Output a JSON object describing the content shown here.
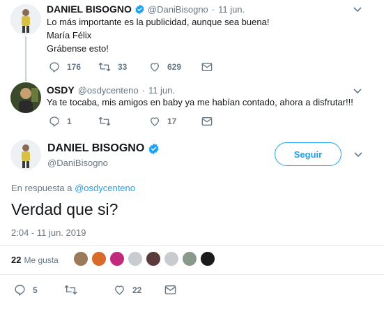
{
  "tweet1": {
    "name": "DANIEL BISOGNO",
    "handle": "@DaniBisogno",
    "separator": "·",
    "date": "11 jun.",
    "lines": [
      "Lo más importante es la publicidad, aunque sea buena!",
      "María Félix",
      "Grábense esto!"
    ],
    "replies": "176",
    "retweets": "33",
    "likes": "629"
  },
  "tweet2": {
    "name": "OSDY",
    "handle": "@osdycenteno",
    "separator": "·",
    "date": "11 jun.",
    "text": "Ya te tocaba, mis amigos en baby ya me habían contado, ahora a disfrutar!!!",
    "replies": "1",
    "retweets": "",
    "likes": "17"
  },
  "main": {
    "name": "DANIEL BISOGNO",
    "handle": "@DaniBisogno",
    "follow_label": "Seguir",
    "reply_prefix": "En respuesta a",
    "reply_to": "@osdycenteno",
    "text": "Verdad que si?",
    "timestamp": "2:04 - 11 jun. 2019",
    "likes_count": "22",
    "likes_label": "Me gusta",
    "liker_colors": [
      "#9a7a5a",
      "#d86a2a",
      "#c02a7a",
      "#c8ccd0",
      "#5a3a3a",
      "#c8ccd0",
      "#8a9a8a",
      "#1a1a1a"
    ],
    "actions": {
      "replies": "5",
      "retweets": "",
      "likes": "22"
    }
  },
  "colors": {
    "accent": "#1da1f2",
    "verified": "#1da1f2",
    "muted": "#657786"
  }
}
